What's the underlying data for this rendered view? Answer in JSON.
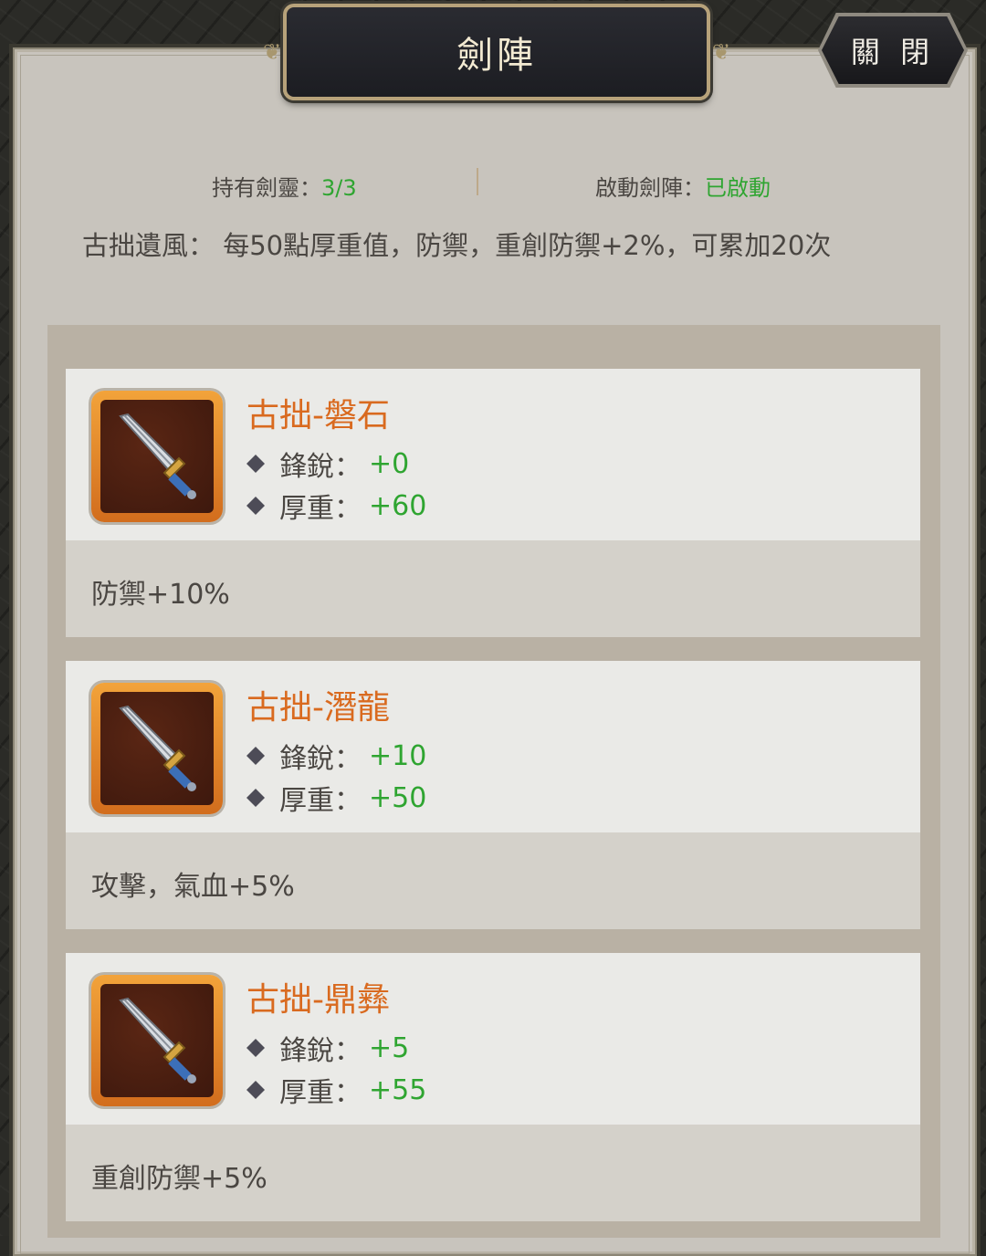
{
  "title": "劍陣",
  "close_label": "關 閉",
  "stats": {
    "owned_label": "持有劍靈：",
    "owned_value": "3/3",
    "activated_label": "啟動劍陣：",
    "activated_value": "已啟動"
  },
  "bonus_text": "古拙遺風：  每50點厚重值，防禦，重創防禦+2%，可累加20次",
  "cards": [
    {
      "name": "古拙-磐石",
      "attr1_label": "鋒銳：",
      "attr1_value": "+0",
      "attr2_label": "厚重：",
      "attr2_value": "+60",
      "effect": "防禦+10%",
      "icon": "sword-icon"
    },
    {
      "name": "古拙-潛龍",
      "attr1_label": "鋒銳：",
      "attr1_value": "+10",
      "attr2_label": "厚重：",
      "attr2_value": "+50",
      "effect": "攻擊，氣血+5%",
      "icon": "sword-icon"
    },
    {
      "name": "古拙-鼎彝",
      "attr1_label": "鋒銳：",
      "attr1_value": "+5",
      "attr2_label": "厚重：",
      "attr2_value": "+55",
      "effect": "重創防禦+5%",
      "icon": "sword-icon"
    }
  ],
  "colors": {
    "accent_orange": "#d96a1f",
    "value_green": "#2fa531",
    "panel_bg": "#c8c4bd"
  }
}
